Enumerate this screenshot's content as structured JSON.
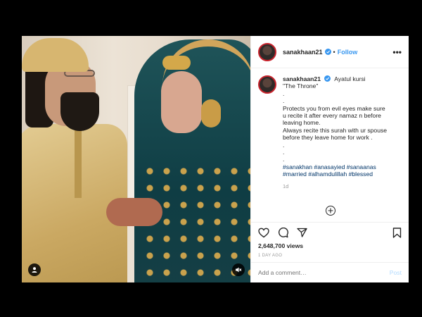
{
  "header": {
    "username": "sanakhaan21",
    "separator": "•",
    "follow_label": "Follow",
    "more_label": "•••"
  },
  "caption": {
    "username": "sanakhaan21",
    "lines": [
      "Ayatul kursi",
      "\"The Throne\"",
      ".",
      ".",
      "Protects you from evil eyes make sure",
      "u recite it after every namaz n before",
      "leaving home.",
      "Always recite this surah with ur spouse",
      "before they leave home for work .",
      ".",
      ".",
      ".",
      "#sanakhan #anasayied #sanaanas",
      "#married #alhamdulillah #blessed"
    ],
    "time_ago": "1d"
  },
  "load_more_icon": "plus-circle-icon",
  "actions": {
    "icons": [
      "heart-icon",
      "comment-icon",
      "share-icon",
      "bookmark-icon"
    ],
    "views": "2,648,700 views",
    "date": "1 DAY AGO"
  },
  "comment": {
    "placeholder": "Add a comment…",
    "post_label": "Post"
  },
  "colors": {
    "link": "#3897f0",
    "hashtag": "#003569",
    "muted": "#999999",
    "story_ring": "#c8232c"
  }
}
